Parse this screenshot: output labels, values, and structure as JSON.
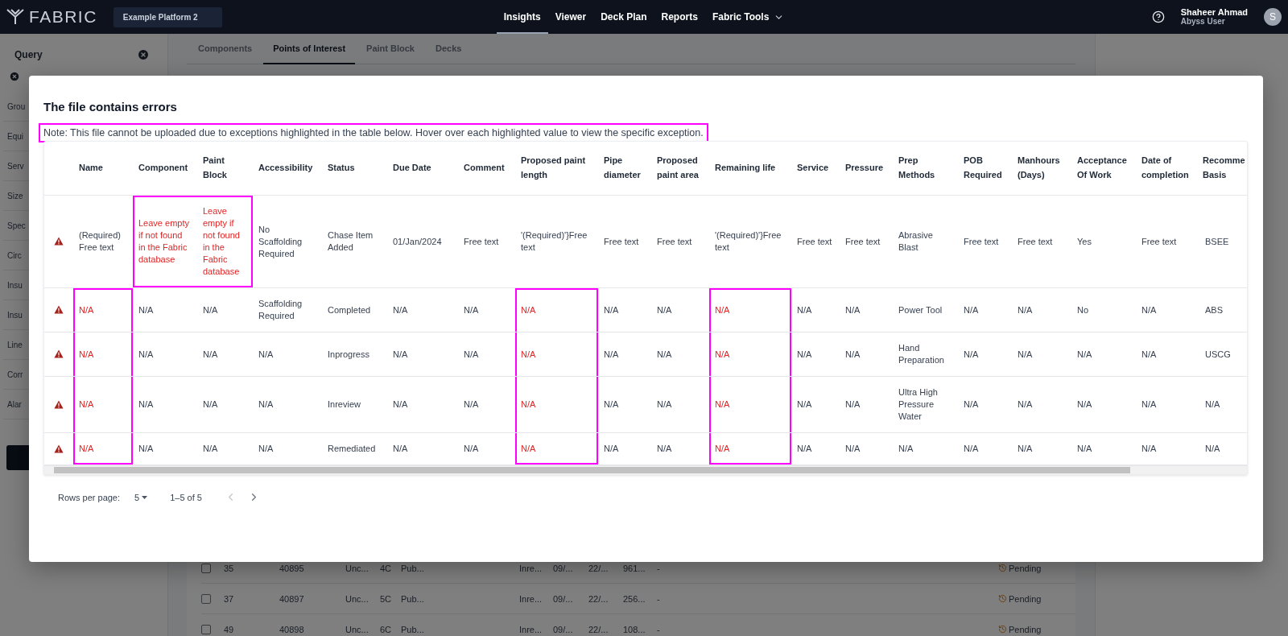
{
  "top_bar": {
    "logo": "FABRIC",
    "platform": "Example Platform 2",
    "nav": [
      {
        "label": "Insights",
        "selected": true,
        "dropdown": false
      },
      {
        "label": "Viewer",
        "selected": false,
        "dropdown": false
      },
      {
        "label": "Deck Plan",
        "selected": false,
        "dropdown": false
      },
      {
        "label": "Reports",
        "selected": false,
        "dropdown": false
      },
      {
        "label": "Fabric Tools",
        "selected": false,
        "dropdown": true
      }
    ],
    "user": {
      "name": "Shaheer Ahmad",
      "role": "Abyss User",
      "initial": "S"
    }
  },
  "sidebar": {
    "title": "Query",
    "items": [
      "Grou",
      "Equi",
      "Serv",
      "Size",
      "Spec",
      "Circ",
      "Insu",
      "Insu",
      "Line",
      "Corr",
      "Alar"
    ]
  },
  "tabs": [
    {
      "label": "Components",
      "selected": false
    },
    {
      "label": "Points of Interest",
      "selected": true
    },
    {
      "label": "Paint Block",
      "selected": false
    },
    {
      "label": "Decks",
      "selected": false
    }
  ],
  "background_rows": [
    {
      "checked": false,
      "cells": [
        "35",
        "40895",
        "Unc...",
        "4C",
        "Pub...",
        "Inre...",
        "09/...",
        "22/...",
        "961...",
        "-"
      ],
      "status": "Pending"
    },
    {
      "checked": false,
      "cells": [
        "37",
        "40897",
        "Unc...",
        "5C",
        "Pub...",
        "Inre...",
        "09/...",
        "22/...",
        "256...",
        "-"
      ],
      "status": "Pending"
    },
    {
      "checked": false,
      "cells": [
        "49",
        "40898",
        "Unc...",
        "6C",
        "Pub...",
        "Inre...",
        "09/...",
        "22/...",
        "108...",
        "-"
      ],
      "status": "Pending"
    }
  ],
  "dialog": {
    "title": "The file contains errors",
    "note": {
      "text": "Note: This file cannot be uploaded due to exceptions highlighted in the table below. Hover over each highlighted value to view the specific exception.",
      "annotated": true
    },
    "table": {
      "columns": [
        "Name",
        "Component",
        "Paint Block",
        "Accessibility",
        "Status",
        "Due Date",
        "Comment",
        "Proposed paint length",
        "Pipe diameter",
        "Proposed paint area",
        "Remaining life",
        "Service",
        "Pressure",
        "Prep Methods",
        "POB Required",
        "Manhours (Days)",
        "Acceptance Of Work",
        "Date of completion",
        "Recomme Basis"
      ],
      "rows": [
        {
          "flagged": true,
          "cells": [
            {
              "text": "(Required) Free text",
              "error": false
            },
            {
              "text": "Leave empty if not found in the Fabric database",
              "error": true
            },
            {
              "text": "Leave empty if not found in the Fabric database",
              "error": true
            },
            {
              "text": "No Scaffolding Required",
              "error": false
            },
            {
              "text": "Chase Item Added",
              "error": false
            },
            {
              "text": "01/Jan/2024",
              "error": false
            },
            {
              "text": "Free text",
              "error": false
            },
            {
              "text": "'(Required)'}Free text",
              "error": false
            },
            {
              "text": "Free text",
              "error": false
            },
            {
              "text": "Free text",
              "error": false
            },
            {
              "text": "'(Required)'}Free text",
              "error": false
            },
            {
              "text": "Free text",
              "error": false
            },
            {
              "text": "Free text",
              "error": false
            },
            {
              "text": "Abrasive Blast",
              "error": false
            },
            {
              "text": "Free text",
              "error": false
            },
            {
              "text": "Free text",
              "error": false
            },
            {
              "text": "Yes",
              "error": false
            },
            {
              "text": "Free text",
              "error": false
            },
            {
              "text": "BSEE",
              "error": false
            }
          ]
        },
        {
          "flagged": true,
          "cells": [
            {
              "text": "N/A",
              "error": true
            },
            {
              "text": "N/A",
              "error": false
            },
            {
              "text": "N/A",
              "error": false
            },
            {
              "text": "Scaffolding Required",
              "error": false
            },
            {
              "text": "Completed",
              "error": false
            },
            {
              "text": "N/A",
              "error": false
            },
            {
              "text": "N/A",
              "error": false
            },
            {
              "text": "N/A",
              "error": true
            },
            {
              "text": "N/A",
              "error": false
            },
            {
              "text": "N/A",
              "error": false
            },
            {
              "text": "N/A",
              "error": true
            },
            {
              "text": "N/A",
              "error": false
            },
            {
              "text": "N/A",
              "error": false
            },
            {
              "text": "Power Tool",
              "error": false
            },
            {
              "text": "N/A",
              "error": false
            },
            {
              "text": "N/A",
              "error": false
            },
            {
              "text": "No",
              "error": false
            },
            {
              "text": "N/A",
              "error": false
            },
            {
              "text": "ABS",
              "error": false
            }
          ]
        },
        {
          "flagged": true,
          "cells": [
            {
              "text": "N/A",
              "error": true
            },
            {
              "text": "N/A",
              "error": false
            },
            {
              "text": "N/A",
              "error": false
            },
            {
              "text": "N/A",
              "error": false
            },
            {
              "text": "Inprogress",
              "error": false
            },
            {
              "text": "N/A",
              "error": false
            },
            {
              "text": "N/A",
              "error": false
            },
            {
              "text": "N/A",
              "error": true
            },
            {
              "text": "N/A",
              "error": false
            },
            {
              "text": "N/A",
              "error": false
            },
            {
              "text": "N/A",
              "error": true
            },
            {
              "text": "N/A",
              "error": false
            },
            {
              "text": "N/A",
              "error": false
            },
            {
              "text": "Hand Preparation",
              "error": false
            },
            {
              "text": "N/A",
              "error": false
            },
            {
              "text": "N/A",
              "error": false
            },
            {
              "text": "N/A",
              "error": false
            },
            {
              "text": "N/A",
              "error": false
            },
            {
              "text": "USCG",
              "error": false
            }
          ]
        },
        {
          "flagged": true,
          "cells": [
            {
              "text": "N/A",
              "error": true
            },
            {
              "text": "N/A",
              "error": false
            },
            {
              "text": "N/A",
              "error": false
            },
            {
              "text": "N/A",
              "error": false
            },
            {
              "text": "Inreview",
              "error": false
            },
            {
              "text": "N/A",
              "error": false
            },
            {
              "text": "N/A",
              "error": false
            },
            {
              "text": "N/A",
              "error": true
            },
            {
              "text": "N/A",
              "error": false
            },
            {
              "text": "N/A",
              "error": false
            },
            {
              "text": "N/A",
              "error": true
            },
            {
              "text": "N/A",
              "error": false
            },
            {
              "text": "N/A",
              "error": false
            },
            {
              "text": "Ultra High Pressure Water",
              "error": false
            },
            {
              "text": "N/A",
              "error": false
            },
            {
              "text": "N/A",
              "error": false
            },
            {
              "text": "N/A",
              "error": false
            },
            {
              "text": "N/A",
              "error": false
            },
            {
              "text": "N/A",
              "error": false
            }
          ]
        },
        {
          "flagged": true,
          "cells": [
            {
              "text": "N/A",
              "error": true
            },
            {
              "text": "N/A",
              "error": false
            },
            {
              "text": "N/A",
              "error": false
            },
            {
              "text": "N/A",
              "error": false
            },
            {
              "text": "Remediated",
              "error": false
            },
            {
              "text": "N/A",
              "error": false
            },
            {
              "text": "N/A",
              "error": false
            },
            {
              "text": "N/A",
              "error": true
            },
            {
              "text": "N/A",
              "error": false
            },
            {
              "text": "N/A",
              "error": false
            },
            {
              "text": "N/A",
              "error": true
            },
            {
              "text": "N/A",
              "error": false
            },
            {
              "text": "N/A",
              "error": false
            },
            {
              "text": "N/A",
              "error": false
            },
            {
              "text": "N/A",
              "error": false
            },
            {
              "text": "N/A",
              "error": false
            },
            {
              "text": "N/A",
              "error": false
            },
            {
              "text": "N/A",
              "error": false
            },
            {
              "text": "N/A",
              "error": false
            }
          ]
        }
      ]
    },
    "pagination": {
      "rows_label": "Rows per page:",
      "rows_value": "5",
      "range": "1–5 of 5"
    }
  }
}
